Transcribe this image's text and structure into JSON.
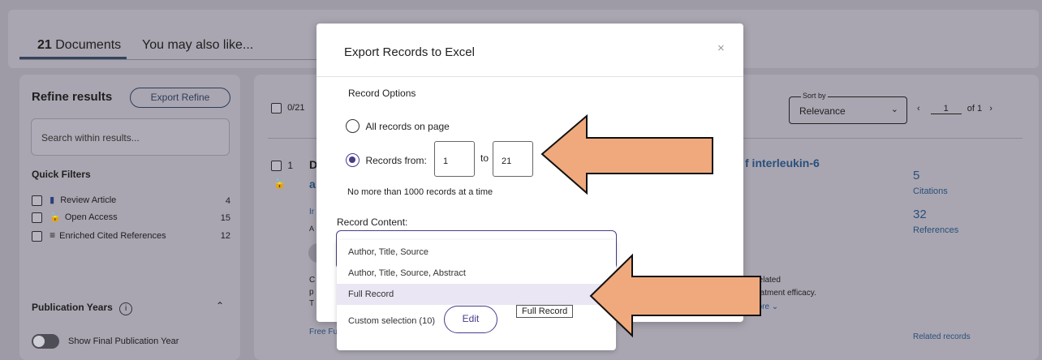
{
  "tabs": {
    "documents_count": "21",
    "documents_label": "Documents",
    "also_like": "You may also like..."
  },
  "sidebar": {
    "refine_title": "Refine results",
    "export_refine": "Export Refine",
    "search_placeholder": "Search within results...",
    "quick_filters_title": "Quick Filters",
    "filters": [
      {
        "label": "Review Article",
        "count": "4"
      },
      {
        "label": "Open Access",
        "count": "15"
      },
      {
        "label": "Enriched Cited References",
        "count": "12"
      }
    ],
    "pub_years_title": "Publication Years",
    "show_final_pub_year": "Show Final Publication Year"
  },
  "results": {
    "select_count": "0/21",
    "sort_label": "Sort by",
    "sort_value": "Relevance",
    "page_current": "1",
    "page_of": "of 1",
    "row_number": "1",
    "row_title_start": "D",
    "row_title_line2": "a",
    "row_title_end": "f interleukin-6",
    "citations_count": "5",
    "citations_label": "Citations",
    "references_count": "32",
    "references_label": "References",
    "related_records": "Related records",
    "snippet_1": "rrelated",
    "snippet_2": "treatment efficacy.",
    "show_more": "nore",
    "free_full": "Free Fu",
    "frag_in": "Ir",
    "frag_a": "A",
    "frag_c": "C",
    "frag_p": "p",
    "frag_t": "T"
  },
  "modal": {
    "title": "Export Records to Excel",
    "record_options": "Record Options",
    "all_records": "All records on page",
    "records_from": "Records from:",
    "from_value": "1",
    "to_label": "to",
    "to_value": "21",
    "limit_note": "No more than 1000 records at a time",
    "record_content": "Record Content:",
    "options": [
      "Author, Title, Source",
      "Author, Title, Source, Abstract",
      "Full Record",
      "Custom selection (10)"
    ],
    "edit_label": "Edit",
    "tooltip": "Full Record"
  }
}
